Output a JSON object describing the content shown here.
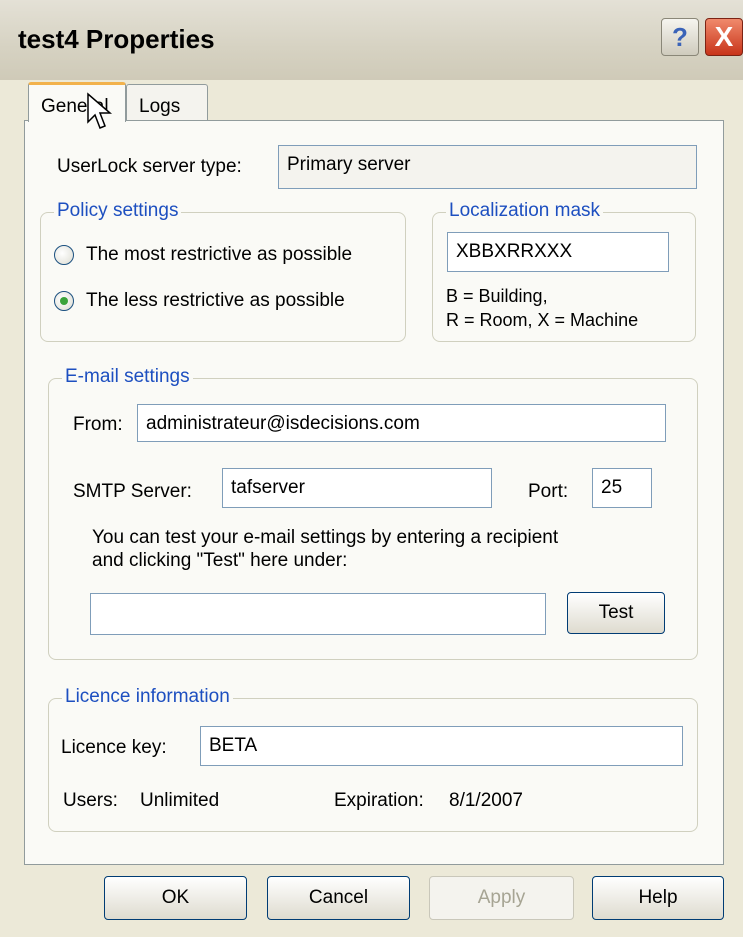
{
  "window": {
    "title": "test4 Properties",
    "help_glyph": "?",
    "close_glyph": "X"
  },
  "tabs": [
    "General",
    "Logs"
  ],
  "server_type": {
    "label": "UserLock server type:",
    "value": "Primary server"
  },
  "policy": {
    "title": "Policy settings",
    "options": [
      {
        "label": "The most restrictive as possible",
        "selected": false
      },
      {
        "label": "The less restrictive as possible",
        "selected": true
      }
    ]
  },
  "localization": {
    "title": "Localization mask",
    "value": "XBBXRRXXX",
    "legend_line1": "B = Building,",
    "legend_line2": "R = Room, X = Machine"
  },
  "email": {
    "title": "E-mail settings",
    "from_label": "From:",
    "from_value": "administrateur@isdecisions.com",
    "smtp_label": "SMTP Server:",
    "smtp_value": "tafserver",
    "port_label": "Port:",
    "port_value": "25",
    "hint_line1": "You can test your e-mail settings by entering a recipient",
    "hint_line2": "and clicking \"Test\" here under:",
    "recipient_value": "",
    "test_label": "Test"
  },
  "licence": {
    "title": "Licence information",
    "key_label": "Licence key:",
    "key_value": "BETA",
    "users_label": "Users:",
    "users_value": "Unlimited",
    "expiration_label": "Expiration:",
    "expiration_value": "8/1/2007"
  },
  "buttons": {
    "ok": "OK",
    "cancel": "Cancel",
    "apply": "Apply",
    "help": "Help"
  },
  "colors": {
    "accent_blue": "#1d4fc0",
    "tab_highlight": "#f2b24c",
    "radio_selected": "#3aa33a"
  }
}
